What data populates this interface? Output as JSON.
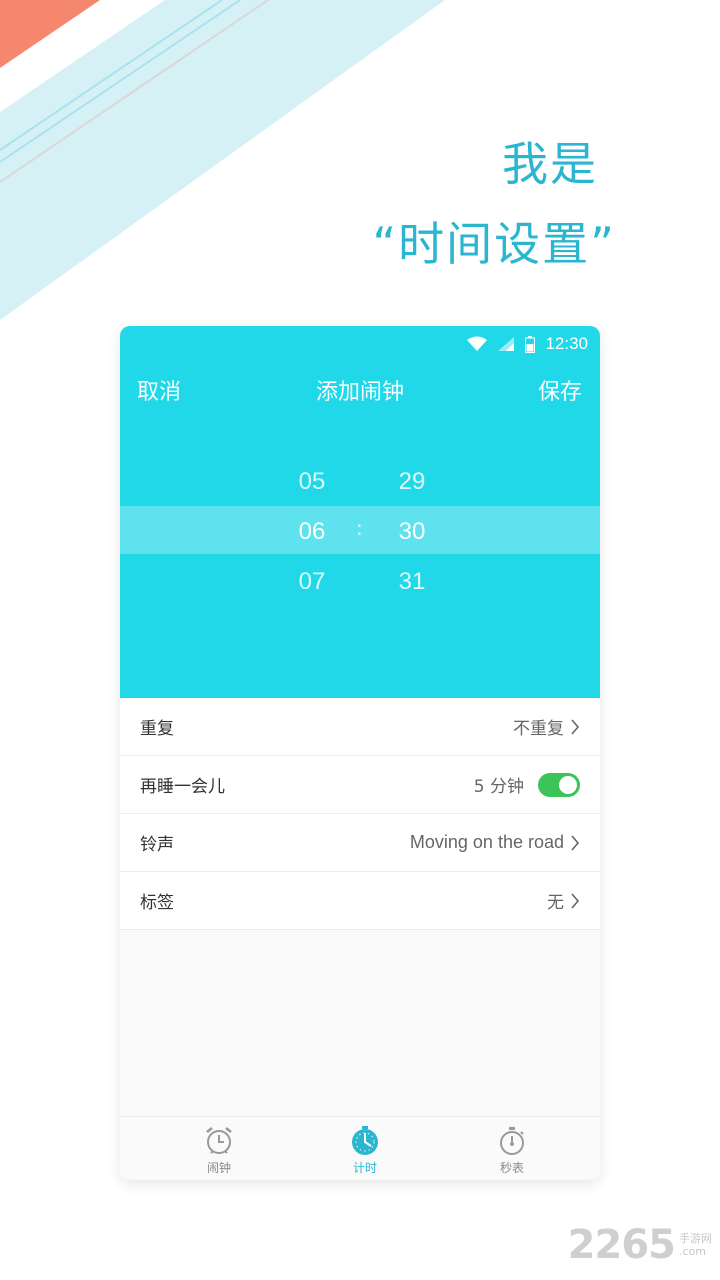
{
  "promo": {
    "line1": "我是",
    "line2": "“时间设置”"
  },
  "status_bar": {
    "time": "12:30",
    "icons": [
      "wifi-icon",
      "signal-icon",
      "battery-icon"
    ]
  },
  "nav": {
    "cancel_label": "取消",
    "title": "添加闹钟",
    "save_label": "保存"
  },
  "picker": {
    "hours": [
      "05",
      "06",
      "07"
    ],
    "minutes": [
      "29",
      "30",
      "31"
    ],
    "separator": ":"
  },
  "settings": [
    {
      "label": "重复",
      "value": "不重复"
    },
    {
      "label": "再睡一会儿",
      "value": "5 分钟",
      "toggle_on": true
    },
    {
      "label": "铃声",
      "value": "Moving on the road"
    },
    {
      "label": "标签",
      "value": "无"
    }
  ],
  "tabs": [
    {
      "label": "闹钟",
      "icon": "alarm-clock-icon"
    },
    {
      "label": "计时",
      "icon": "timer-icon",
      "active": true
    },
    {
      "label": "秒表",
      "icon": "stopwatch-icon"
    }
  ],
  "watermark": {
    "number": "2265",
    "sub_top": "手游网",
    "sub_bottom": ".com"
  },
  "colors": {
    "accent": "#20d8e8",
    "promo_text": "#2bb6cf",
    "toggle_on": "#3cc45a",
    "deco_coral": "#f4876e",
    "deco_light_blue": "#d6f1f6"
  }
}
